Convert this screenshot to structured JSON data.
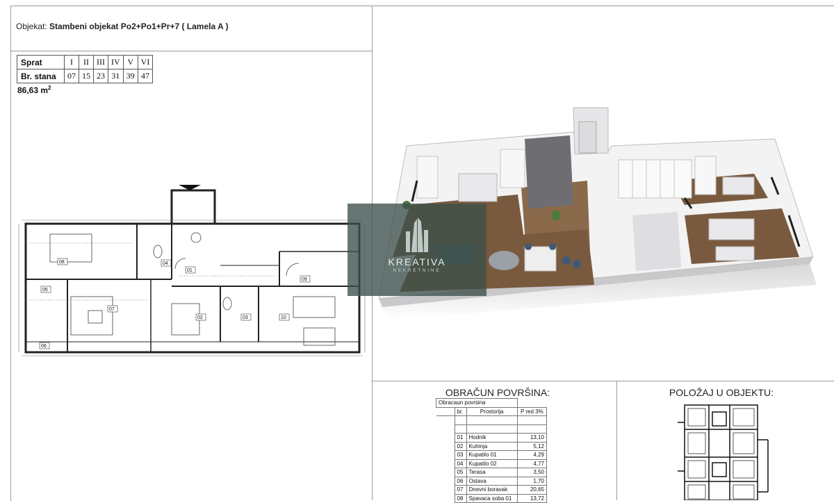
{
  "header": {
    "object_prefix": "Objekat:",
    "object_name": "Stambeni objekat Po2+Po1+Pr+7 ( Lamela A )"
  },
  "floors_table": {
    "row1_label": "Sprat",
    "floors": [
      "I",
      "II",
      "III",
      "IV",
      "V",
      "VI"
    ],
    "row2_label": "Br. stana",
    "apartments": [
      "07",
      "15",
      "23",
      "31",
      "39",
      "47"
    ]
  },
  "apartment_area": "86,63 m",
  "apartment_area_unit_sup": "2",
  "plan": {
    "room_tags": [
      "01",
      "02",
      "03",
      "04",
      "05",
      "06",
      "07",
      "08",
      "09",
      "10"
    ]
  },
  "watermark": {
    "brand": "KREATIVA",
    "subtitle": "NEKRETNINE"
  },
  "area_calc": {
    "title": "OBRAČUN POVRŠINA:",
    "caption": "Obracaun povrsina",
    "col_no": "br.",
    "col_room": "Prostorija",
    "col_area": "P red 3%",
    "rows": [
      {
        "no": "01",
        "room": "Hodnik",
        "area": "13,10"
      },
      {
        "no": "02",
        "room": "Kuhinja",
        "area": "5,12"
      },
      {
        "no": "03",
        "room": "Kupatilo 01",
        "area": "4,29"
      },
      {
        "no": "04",
        "room": "Kupatilo 02",
        "area": "4,77"
      },
      {
        "no": "05",
        "room": "Terasa",
        "area": "3,50"
      },
      {
        "no": "06",
        "room": "Ostava",
        "area": "1,70"
      },
      {
        "no": "07",
        "room": "Dnevni boravak",
        "area": "20,65"
      },
      {
        "no": "08",
        "room": "Spavaca soba 01",
        "area": "13,72"
      }
    ]
  },
  "position": {
    "title": "POLOŽAJ U OBJEKTU:"
  },
  "colors": {
    "grid_line": "#9a9a9a",
    "watermark_bg": "#3c504b",
    "floor_wood": "#7a5a3e",
    "wall_white": "#f3f3f3"
  }
}
